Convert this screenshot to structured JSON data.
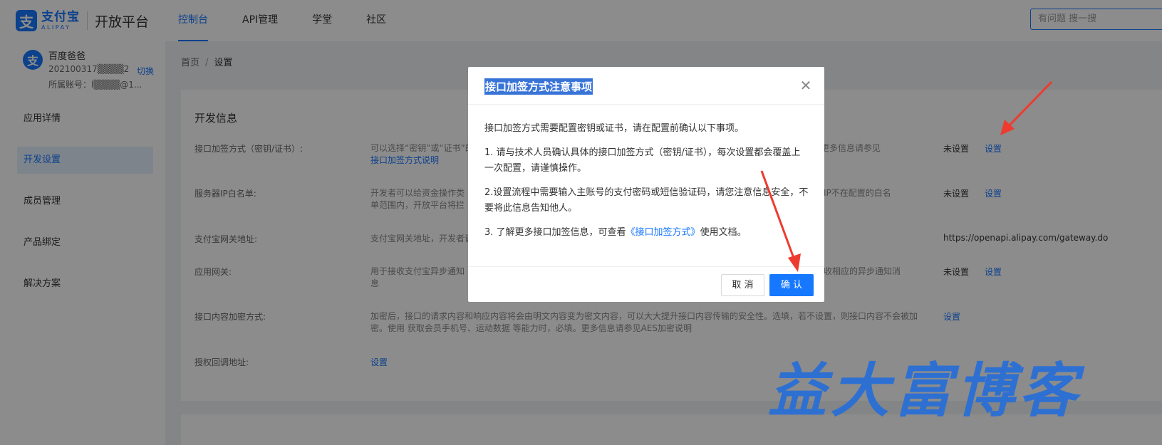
{
  "header": {
    "logo_cn": "支付宝",
    "logo_en": "ALIPAY",
    "platform": "开放平台",
    "nav": [
      {
        "label": "控制台",
        "active": true
      },
      {
        "label": "API管理",
        "active": false
      },
      {
        "label": "学堂",
        "active": false
      },
      {
        "label": "社区",
        "active": false
      }
    ],
    "search_placeholder": "有问题 搜一搜"
  },
  "account": {
    "name": "百度爸爸",
    "id": "202100317▒▒▒▒2",
    "switch": "切换",
    "sub": "所属账号：l▒▒▒▒@1..."
  },
  "sidebar": {
    "items": [
      {
        "label": "应用详情",
        "active": false
      },
      {
        "label": "开发设置",
        "active": true
      },
      {
        "label": "成员管理",
        "active": false
      },
      {
        "label": "产品绑定",
        "active": false
      },
      {
        "label": "解决方案",
        "active": false
      }
    ]
  },
  "breadcrumb": {
    "home": "首页",
    "sep": "/",
    "current": "设置"
  },
  "dev": {
    "title": "开发信息",
    "rows": [
      {
        "label": "接口加签方式（密钥/证书）:",
        "desc1": "可以选择“密钥”或“证书”的",
        "desc1b": "口。更多信息请参见",
        "desc2": "接口加签方式说明",
        "status": "未设置",
        "action": "设置"
      },
      {
        "label": "服务器IP白名单:",
        "desc1": "开发者可以给资金操作类",
        "desc1b": "IP不在配置的白名",
        "desc2": "单范围内，开放平台将拦",
        "status": "未设置",
        "action": "设置"
      },
      {
        "label": "支付宝网关地址:",
        "desc1": "支付宝网关地址，开发者调",
        "desc1b": "",
        "desc2": "",
        "status": "https://openapi.alipay.com/gateway.do",
        "action": ""
      },
      {
        "label": "应用网关:",
        "desc1": "用于接收支付宝异步通知",
        "desc1b": "收相应的异步通知消",
        "desc2": "息",
        "status": "未设置",
        "action": "设置"
      },
      {
        "label": "接口内容加密方式:",
        "desc1": "加密后，接口的请求内容和响应内容将会由明文内容变为密文内容，可以大大提升接口内容传输的安全性。选填，若不设置，则接口内容不会被加",
        "desc1b": "",
        "desc2": "密。使用 获取会员手机号、运动数据 等能力时，必填。更多信息请参见AES加密说明",
        "status": "",
        "action": "设置"
      },
      {
        "label": "授权回调地址:",
        "desc1": "",
        "desc1b": "",
        "desc2": "",
        "status": "",
        "action": "设置"
      }
    ]
  },
  "modal": {
    "title": "接口加签方式注意事项",
    "intro": "接口加签方式需要配置密钥或证书，请在配置前确认以下事项。",
    "item1": "1. 请与技术人员确认具体的接口加签方式（密钥/证书），每次设置都会覆盖上一次配置，请谨慎操作。",
    "item2": "2.设置流程中需要输入主账号的支付密码或短信验证码，请您注意信息安全，不要将此信息告知他人。",
    "item3_pre": "3. 了解更多接口加签信息，可查看",
    "item3_link": "《接口加签方式》",
    "item3_post": "使用文档。",
    "cancel": "取 消",
    "ok": "确 认"
  },
  "watermark": "益大富博客",
  "colors": {
    "accent": "#1677ff",
    "annotation": "#ee3b2f"
  }
}
